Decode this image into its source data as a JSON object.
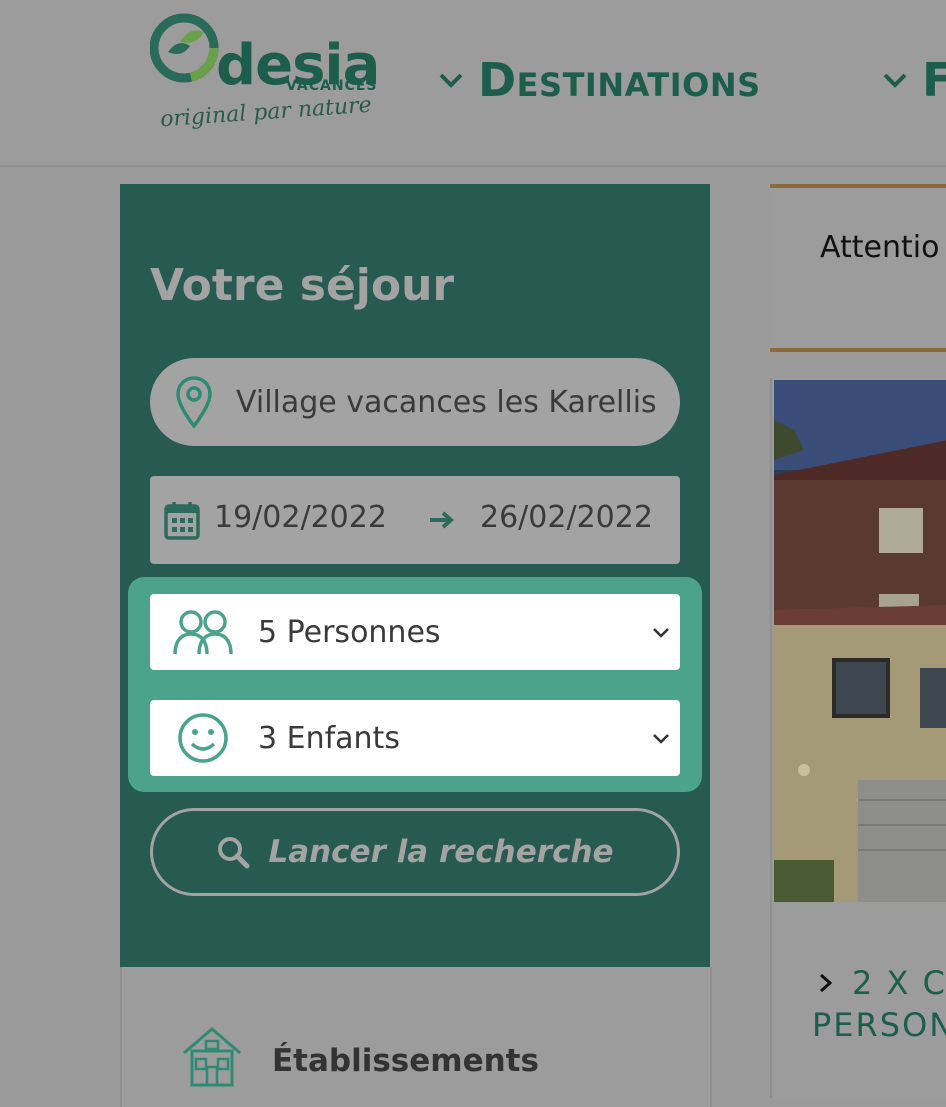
{
  "header": {
    "logo": {
      "brand": "desia",
      "sub": "VACANCES",
      "tagline": "original par nature"
    },
    "nav": [
      {
        "label": "Destinations",
        "icon": "chevron-down-icon"
      },
      {
        "label": "F",
        "icon": "chevron-down-icon"
      }
    ]
  },
  "search_panel": {
    "title": "Votre séjour",
    "location": {
      "value": "Village vacances les Karellis",
      "icon": "map-pin-icon"
    },
    "dates": {
      "start": "19/02/2022",
      "end": "26/02/2022",
      "icon": "calendar-icon",
      "separator_icon": "arrow-right-icon"
    },
    "persons": {
      "value": "5 Personnes",
      "icon": "people-icon"
    },
    "children": {
      "value": "3 Enfants",
      "icon": "smiley-icon"
    },
    "search_button": {
      "label": "Lancer la recherche",
      "icon": "search-icon"
    }
  },
  "establishments": {
    "label": "Établissements",
    "icon": "house-icon"
  },
  "notice": {
    "text": "Attentio"
  },
  "room_card": {
    "title_line1": "2 X C",
    "title_line2": "PERSON"
  },
  "colors": {
    "panel_bg": "#275a50",
    "highlight": "#4aa38a",
    "brand_green": "#1d5d4b",
    "notice_border": "#8c6a3c",
    "overlay_gray": "#9c9c9c"
  }
}
